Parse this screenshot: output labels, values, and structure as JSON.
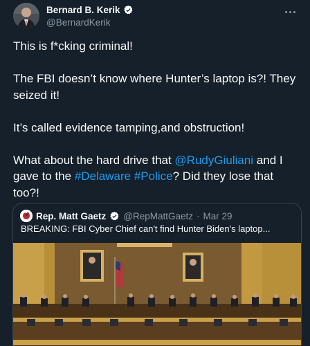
{
  "tweet": {
    "author": {
      "display_name": "Bernard B. Kerik",
      "handle": "@BernardKerik",
      "verified": true
    },
    "menu_icon": "more-horizontal-icon",
    "text": {
      "line1": "This is f*cking criminal!",
      "para2": "The FBI doesn’t know where Hunter’s laptop is?! They seized it!",
      "para3": "It’s called evidence tamping,and obstruction!",
      "para4_pre": "What about the hard drive that ",
      "mention": "@RudyGiuliani",
      "para4_mid": " and I gave to the ",
      "hashtag1": "#Delaware",
      "space": " ",
      "hashtag2": "#Police",
      "para4_post": "? Did they lose that too?!"
    },
    "quoted": {
      "display_name": "Rep. Matt Gaetz",
      "handle": "@RepMattGaetz",
      "separator": "·",
      "date": "Mar 29",
      "verified": true,
      "text": "BREAKING: FBI Cyber Chief can't find Hunter Biden's laptop..."
    }
  },
  "colors": {
    "background": "#15202b",
    "link": "#1d9bf0",
    "secondary_text": "#8b98a5",
    "verified_badge": "#ffffff"
  }
}
